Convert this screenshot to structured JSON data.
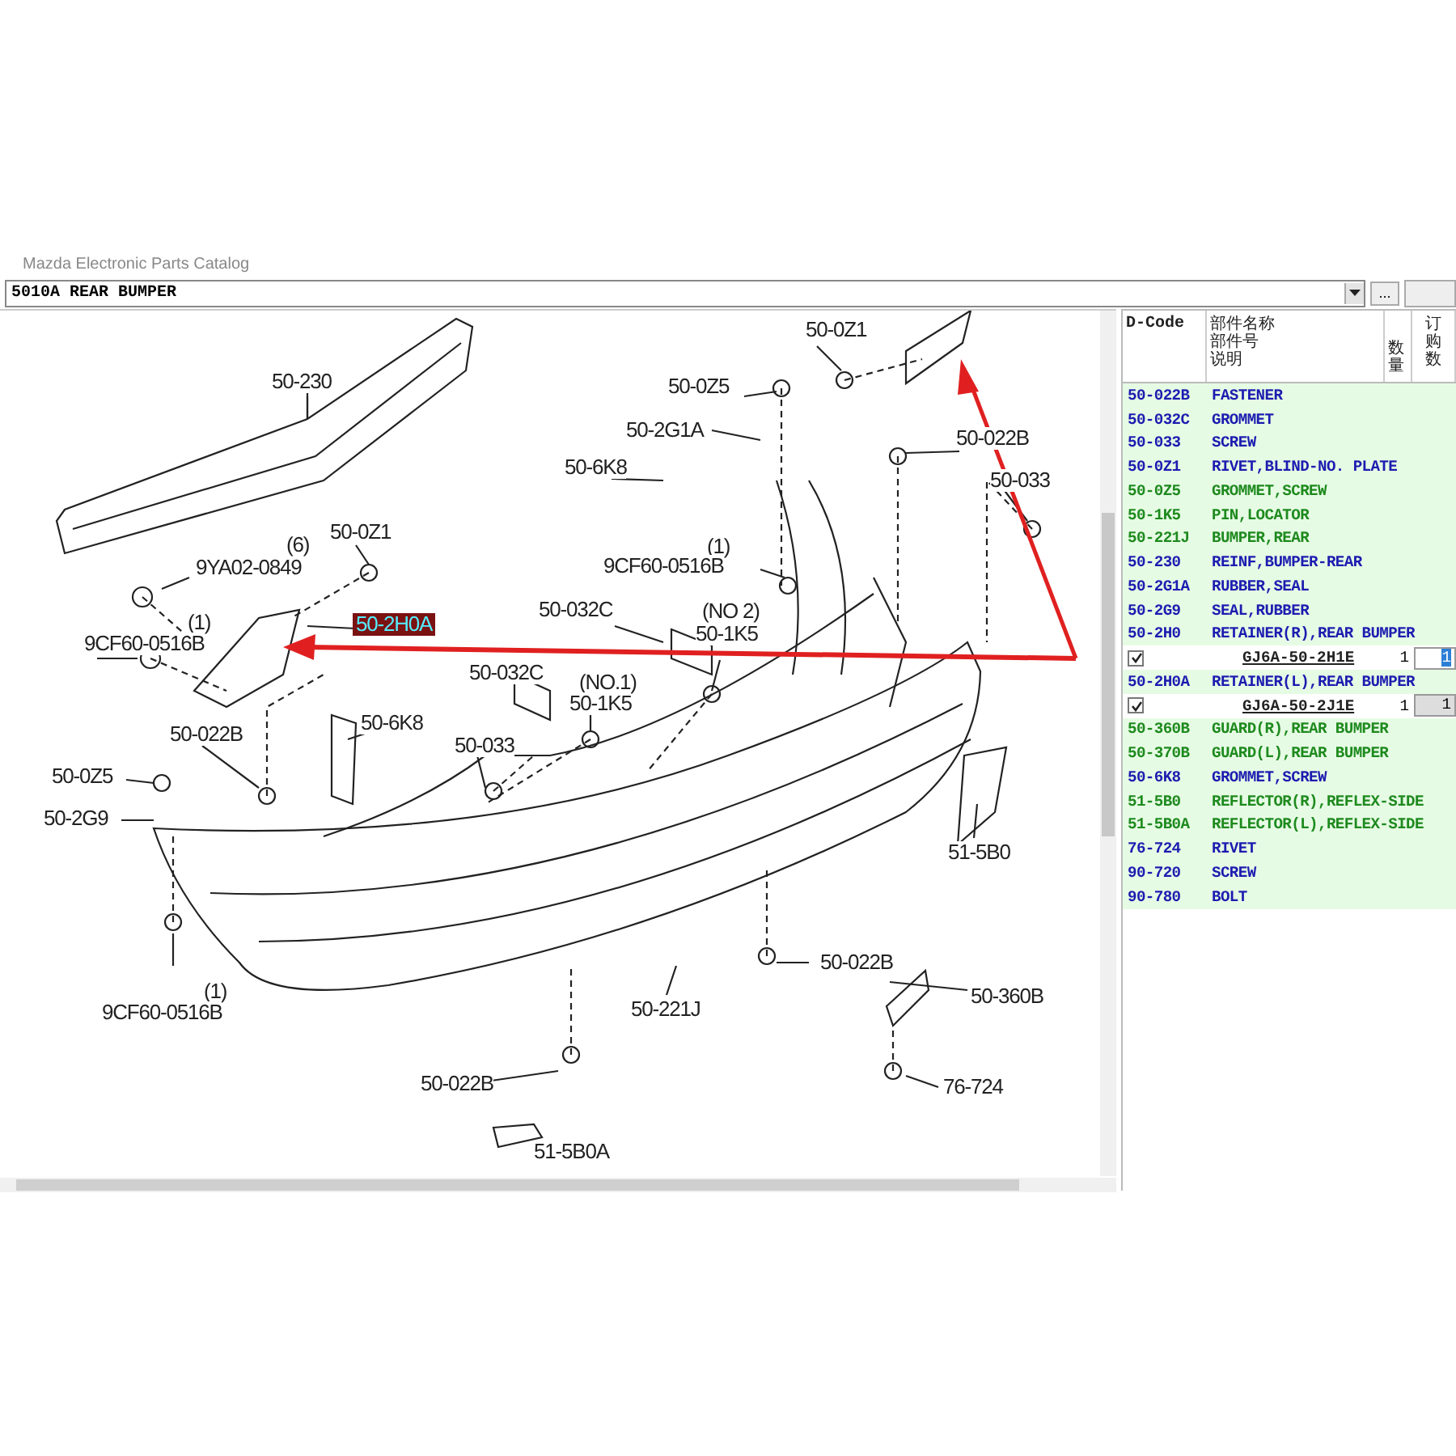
{
  "window": {
    "title": "Mazda Electronic Parts Catalog"
  },
  "section_selector": {
    "value": "5010A  REAR BUMPER"
  },
  "browse_button": {
    "label": "..."
  },
  "diagram": {
    "callouts": [
      {
        "text": "50-0Z1",
        "selected": false
      },
      {
        "text": "50-230",
        "selected": false
      },
      {
        "text": "50-0Z5",
        "selected": false
      },
      {
        "text": "50-2G1A",
        "selected": false
      },
      {
        "text": "50-022B",
        "selected": false
      },
      {
        "text": "50-6K8",
        "selected": false
      },
      {
        "text": "50-033",
        "selected": false
      },
      {
        "text": "(6)",
        "selected": false
      },
      {
        "text": "50-0Z1",
        "selected": false
      },
      {
        "text": "9YA02-0849",
        "selected": false
      },
      {
        "text": "(1)",
        "selected": false
      },
      {
        "text": "9CF60-0516B",
        "selected": false
      },
      {
        "text": "(1)",
        "selected": false
      },
      {
        "text": "50-032C",
        "selected": false
      },
      {
        "text": "(NO 2)",
        "selected": false
      },
      {
        "text": "50-2H0A",
        "selected": true
      },
      {
        "text": "9CF60-0516B",
        "selected": false
      },
      {
        "text": "50-1K5",
        "selected": false
      },
      {
        "text": "50-032C",
        "selected": false
      },
      {
        "text": "(NO.1)",
        "selected": false
      },
      {
        "text": "50-1K5",
        "selected": false
      },
      {
        "text": "50-6K8",
        "selected": false
      },
      {
        "text": "50-022B",
        "selected": false
      },
      {
        "text": "50-033",
        "selected": false
      },
      {
        "text": "50-0Z5",
        "selected": false
      },
      {
        "text": "50-2G9",
        "selected": false
      },
      {
        "text": "51-5B0",
        "selected": false
      },
      {
        "text": "50-022B",
        "selected": false
      },
      {
        "text": "50-360B",
        "selected": false
      },
      {
        "text": "(1)",
        "selected": false
      },
      {
        "text": "50-221J",
        "selected": false
      },
      {
        "text": "9CF60-0516B",
        "selected": false
      },
      {
        "text": "50-022B",
        "selected": false
      },
      {
        "text": "76-724",
        "selected": false
      },
      {
        "text": "51-5B0A",
        "selected": false
      }
    ]
  },
  "parts_table": {
    "columns": [
      {
        "lines": [
          "D-Code"
        ]
      },
      {
        "lines": [
          "部件名称",
          "部件号",
          "说明"
        ]
      },
      {
        "lines": [
          "数量"
        ]
      },
      {
        "lines": [
          "订购数"
        ]
      }
    ],
    "rows": [
      {
        "kind": "part",
        "code": "50-022B",
        "name": "FASTENER",
        "color": "#1c1cb0"
      },
      {
        "kind": "part",
        "code": "50-032C",
        "name": "GROMMET",
        "color": "#1c1cb0"
      },
      {
        "kind": "part",
        "code": "50-033",
        "name": "SCREW",
        "color": "#1c1cb0"
      },
      {
        "kind": "part",
        "code": "50-0Z1",
        "name": "RIVET,BLIND-NO. PLATE",
        "color": "#1c1cb0"
      },
      {
        "kind": "part",
        "code": "50-0Z5",
        "name": "GROMMET,SCREW",
        "color": "#1e8a1e"
      },
      {
        "kind": "part",
        "code": "50-1K5",
        "name": "PIN,LOCATOR",
        "color": "#1e8a1e"
      },
      {
        "kind": "part",
        "code": "50-221J",
        "name": "BUMPER,REAR",
        "color": "#1e8a1e"
      },
      {
        "kind": "part",
        "code": "50-230",
        "name": "REINF,BUMPER-REAR",
        "color": "#1c1cb0"
      },
      {
        "kind": "part",
        "code": "50-2G1A",
        "name": "RUBBER,SEAL",
        "color": "#1c1cb0"
      },
      {
        "kind": "part",
        "code": "50-2G9",
        "name": "SEAL,RUBBER",
        "color": "#1c1cb0"
      },
      {
        "kind": "part",
        "code": "50-2H0",
        "name": "RETAINER(R),REAR BUMPER",
        "color": "#1c1cb0"
      },
      {
        "kind": "variant",
        "checked": true,
        "part_number": "GJ6A-50-2H1E",
        "quantity": "1",
        "order_quantity": "1",
        "selected": true
      },
      {
        "kind": "part",
        "code": "50-2H0A",
        "name": "RETAINER(L),REAR BUMPER",
        "color": "#1c1cb0"
      },
      {
        "kind": "variant",
        "checked": true,
        "part_number": "GJ6A-50-2J1E",
        "quantity": "1",
        "order_quantity": "1",
        "selected": false
      },
      {
        "kind": "part",
        "code": "50-360B",
        "name": "GUARD(R),REAR BUMPER",
        "color": "#1e8a1e"
      },
      {
        "kind": "part",
        "code": "50-370B",
        "name": "GUARD(L),REAR BUMPER",
        "color": "#1e8a1e"
      },
      {
        "kind": "part",
        "code": "50-6K8",
        "name": "GROMMET,SCREW",
        "color": "#1c1cb0"
      },
      {
        "kind": "part",
        "code": "51-5B0",
        "name": "REFLECTOR(R),REFLEX-SIDE",
        "color": "#1e8a1e"
      },
      {
        "kind": "part",
        "code": "51-5B0A",
        "name": "REFLECTOR(L),REFLEX-SIDE",
        "color": "#1e8a1e"
      },
      {
        "kind": "part",
        "code": "76-724",
        "name": "RIVET",
        "color": "#1c1cb0"
      },
      {
        "kind": "part",
        "code": "90-720",
        "name": "SCREW",
        "color": "#1c1cb0"
      },
      {
        "kind": "part",
        "code": "90-780",
        "name": "BOLT",
        "color": "#1c1cb0"
      }
    ]
  }
}
